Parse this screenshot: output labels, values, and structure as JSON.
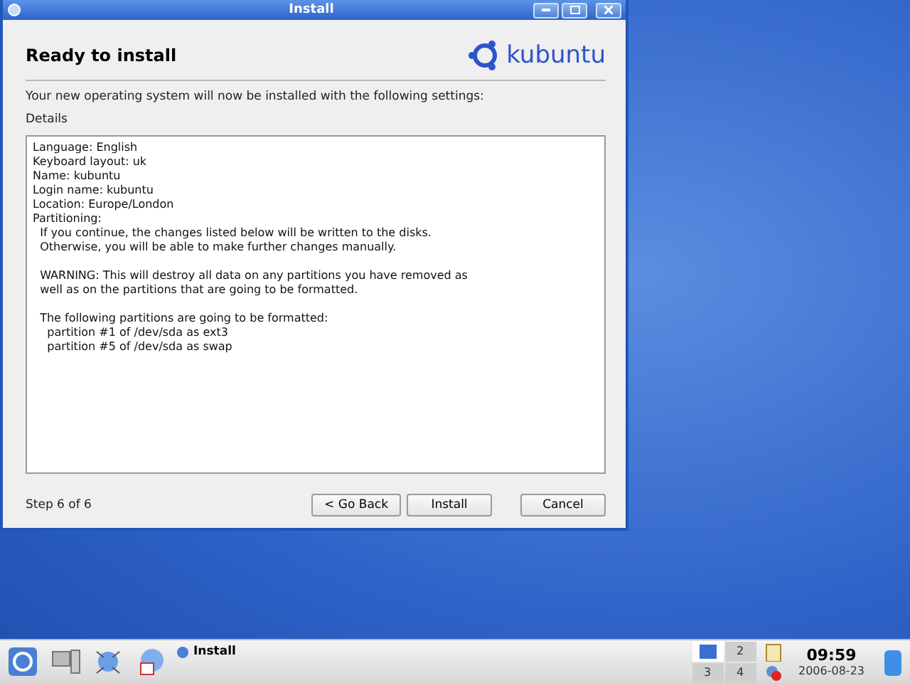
{
  "window": {
    "title": "Install"
  },
  "header": {
    "title": "Ready to install",
    "logo_text": "kubuntu"
  },
  "intro": "Your new operating system will now be installed with the following settings:",
  "details_label": "Details",
  "details_paragraphs": [
    [
      "Language: English",
      "Keyboard layout: uk",
      "Name: kubuntu",
      "Login name: kubuntu",
      "Location: Europe/London",
      "Partitioning:",
      "  If you continue, the changes listed below will be written to the disks.",
      "  Otherwise, you will be able to make further changes manually."
    ],
    [
      "  WARNING: This will destroy all data on any partitions you have removed as",
      "  well as on the partitions that are going to be formatted."
    ],
    [
      "  The following partitions are going to be formatted:",
      "    partition #1 of /dev/sda as ext3",
      "    partition #5 of /dev/sda as swap"
    ]
  ],
  "step": "Step 6 of 6",
  "buttons": [
    "< Go Back",
    "Install",
    "Cancel"
  ],
  "taskbar": {
    "task": "Install",
    "pager": [
      {
        "selected": true
      },
      {
        "label": "2",
        "selected": false
      },
      {
        "label": "3",
        "selected": false
      },
      {
        "label": "4",
        "selected": false
      }
    ],
    "time": "09:59",
    "date": "2006-08-23"
  }
}
